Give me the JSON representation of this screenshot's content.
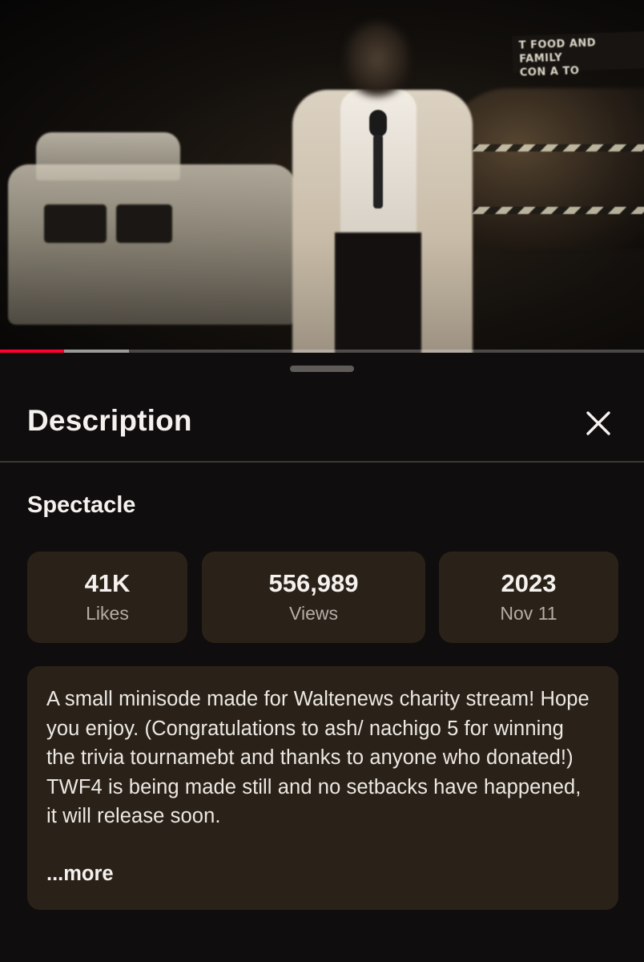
{
  "player": {
    "progress_played": 0.1,
    "progress_buffered": 0.2,
    "played_color": "#ff0033"
  },
  "video_scene": {
    "sign_line1": "T FOOD AND FAMILY",
    "sign_line2": "CON  A TO"
  },
  "sheet": {
    "title": "Description",
    "close_icon": "close-icon"
  },
  "video": {
    "title": "Spectacle",
    "stats": [
      {
        "value": "41K",
        "label": "Likes"
      },
      {
        "value": "556,989",
        "label": "Views"
      },
      {
        "value": "2023",
        "label": "Nov 11"
      }
    ],
    "description": "A small minisode made for Waltenews charity stream! Hope you enjoy. (Congratulations to ash/ nachigo 5 for winning the trivia tournamebt and thanks to anyone who donated!) TWF4 is being made still and no setbacks have happened, it will release soon.",
    "more_label": "...more"
  }
}
